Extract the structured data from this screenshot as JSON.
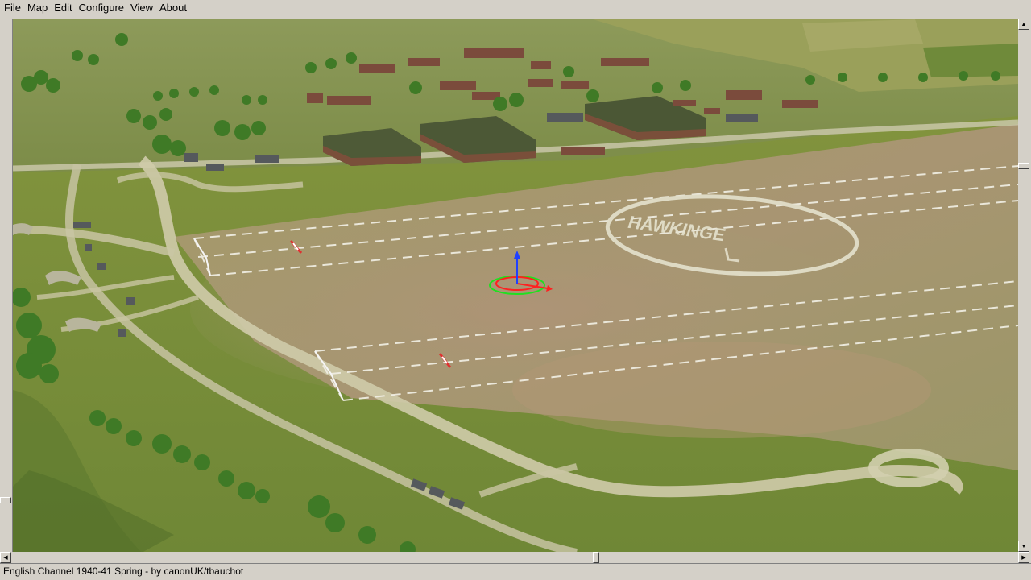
{
  "menu": {
    "items": [
      "File",
      "Map",
      "Edit",
      "Configure",
      "View",
      "About"
    ]
  },
  "viewport": {
    "scene": "airfield-3d-view",
    "ground_marking_text": "HAWKINGE",
    "gizmo_colors": {
      "x_axis": "#ff2020",
      "y_axis": "#20e020",
      "z_axis": "#2040ff"
    }
  },
  "status": {
    "text": "English Channel 1940-41 Spring - by canonUK/tbauchot"
  },
  "icons": {
    "scroll_up": "triangle-up-icon",
    "scroll_down": "triangle-down-icon",
    "scroll_left": "triangle-left-icon",
    "scroll_right": "triangle-right-icon"
  }
}
